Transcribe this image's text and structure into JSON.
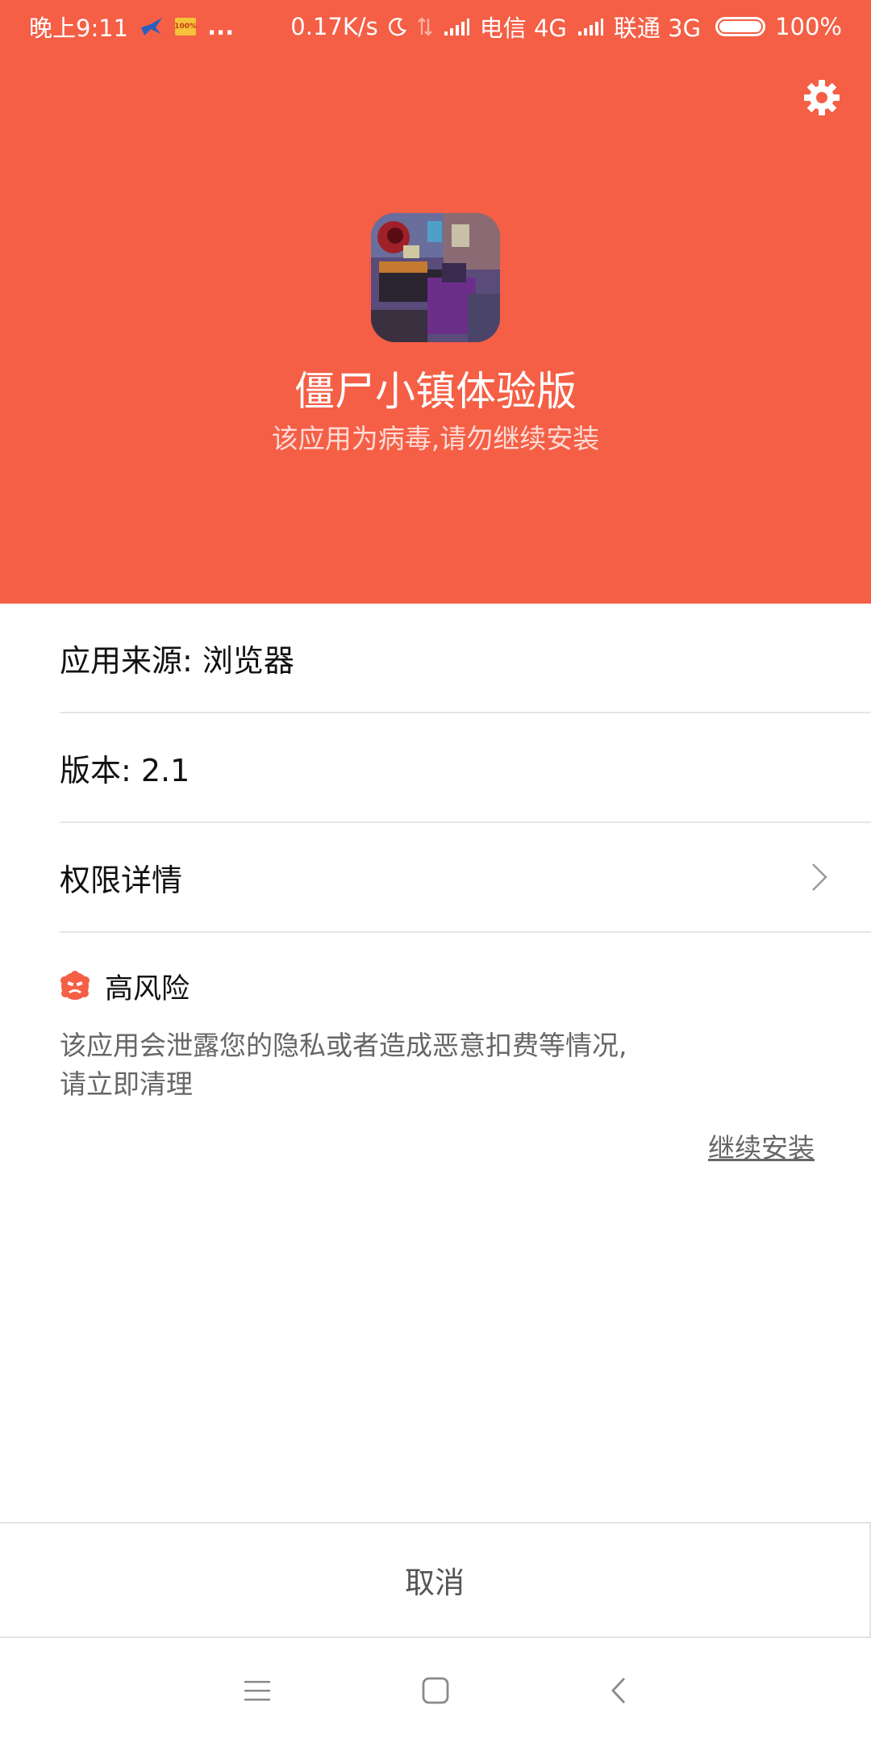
{
  "status_bar": {
    "time": "晚上9:11",
    "more": "...",
    "net_speed": "0.17K/s",
    "carrier1": "电信 4G",
    "carrier2": "联通 3G",
    "battery": "100%",
    "badge_text": "100%"
  },
  "header": {
    "app_name": "僵尸小镇体验版",
    "warning": "该应用为病毒,请勿继续安装",
    "bg_color": "#f45f46",
    "settings_icon": "gear-icon"
  },
  "info": {
    "source": "应用来源: 浏览器",
    "version": "版本: 2.1",
    "permissions": "权限详情"
  },
  "risk": {
    "title": "高风险",
    "description": "该应用会泄露您的隐私或者造成恶意扣费等情况, 请立即清理",
    "icon_color": "#f45f46"
  },
  "continue_install": "继续安装",
  "cancel": "取消",
  "nav": {
    "menu_icon": "menu-icon",
    "home_icon": "home-icon",
    "back_icon": "back-icon"
  }
}
